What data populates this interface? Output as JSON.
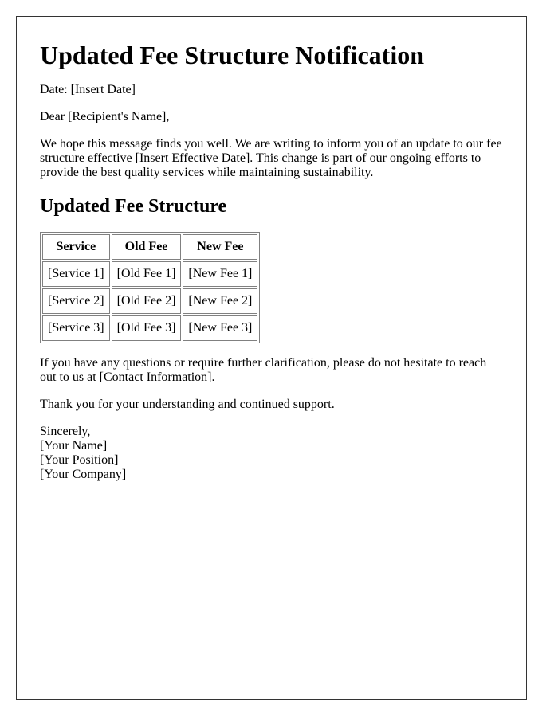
{
  "document": {
    "title": "Updated Fee Structure Notification",
    "date_line": "Date: [Insert Date]",
    "salutation": "Dear [Recipient's Name],",
    "intro_paragraph": "We hope this message finds you well. We are writing to inform you of an update to our fee structure effective [Insert Effective Date]. This change is part of our ongoing efforts to provide the best quality services while maintaining sustainability.",
    "section_heading": "Updated Fee Structure",
    "fee_table": {
      "headers": [
        "Service",
        "Old Fee",
        "New Fee"
      ],
      "rows": [
        [
          "[Service 1]",
          "[Old Fee 1]",
          "[New Fee 1]"
        ],
        [
          "[Service 2]",
          "[Old Fee 2]",
          "[New Fee 2]"
        ],
        [
          "[Service 3]",
          "[Old Fee 3]",
          "[New Fee 3]"
        ]
      ]
    },
    "contact_paragraph": "If you have any questions or require further clarification, please do not hesitate to reach out to us at [Contact Information].",
    "thanks_paragraph": "Thank you for your understanding and continued support.",
    "signature": {
      "closing": "Sincerely,",
      "name": "[Your Name]",
      "position": "[Your Position]",
      "company": "[Your Company]"
    }
  },
  "colors": {
    "text": "#000000",
    "page_border": "#333333",
    "table_border": "#808080",
    "background": "#ffffff"
  }
}
